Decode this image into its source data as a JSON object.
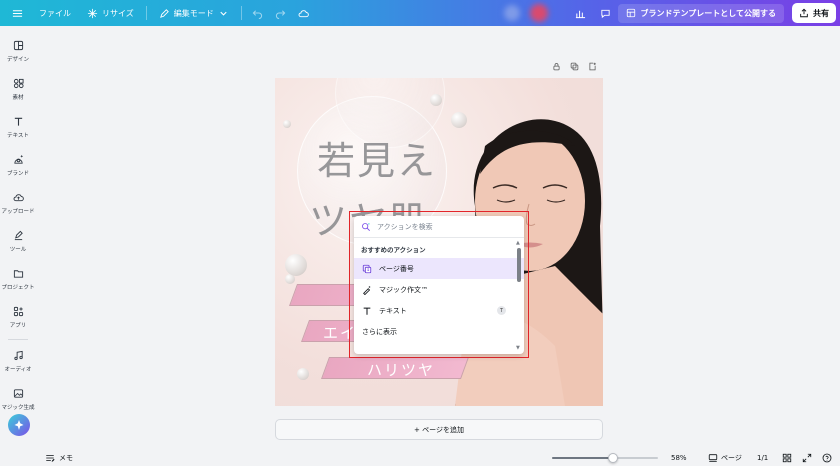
{
  "topbar": {
    "menu_icon": "hamburger-icon",
    "file": "ファイル",
    "resize": "リサイズ",
    "edit_mode": "編集モード",
    "publish_template": "ブランドテンプレートとして公開する",
    "share": "共有"
  },
  "sidebar": {
    "items": [
      {
        "label": "デザイン",
        "icon": "layout-icon"
      },
      {
        "label": "素材",
        "icon": "shapes-icon"
      },
      {
        "label": "テキスト",
        "icon": "text-icon"
      },
      {
        "label": "ブランド",
        "icon": "brand-icon"
      },
      {
        "label": "アップロード",
        "icon": "cloud-upload-icon"
      },
      {
        "label": "ツール",
        "icon": "pen-icon"
      },
      {
        "label": "プロジェクト",
        "icon": "folder-icon"
      },
      {
        "label": "アプリ",
        "icon": "apps-icon"
      },
      {
        "label": "オーディオ",
        "icon": "music-icon"
      },
      {
        "label": "マジック生成",
        "icon": "magic-image-icon"
      }
    ]
  },
  "design": {
    "headline_1": "若見え",
    "headline_2": "ツヤ肌",
    "ribbon_2": "エイ",
    "ribbon_3": "ハリツヤ"
  },
  "popup": {
    "search_placeholder": "アクションを検索",
    "section_title": "おすすめのアクション",
    "items": [
      {
        "label": "ページ番号",
        "icon": "page-number-icon",
        "active": true
      },
      {
        "label": "マジック作文™",
        "icon": "magic-write-icon"
      },
      {
        "label": "テキスト",
        "icon": "text-icon",
        "shortcut": "T"
      },
      {
        "label": "さらに表示"
      }
    ]
  },
  "add_page": "+ ページを追加",
  "bottombar": {
    "memo": "メモ",
    "zoom": "58%",
    "zoom_level": 0.58,
    "pages": "ページ",
    "page_count": "1/1"
  },
  "colors": {
    "accent": "#7a3fe6",
    "highlight_frame": "#e3252a",
    "ribbon": "#f2b9d0"
  }
}
